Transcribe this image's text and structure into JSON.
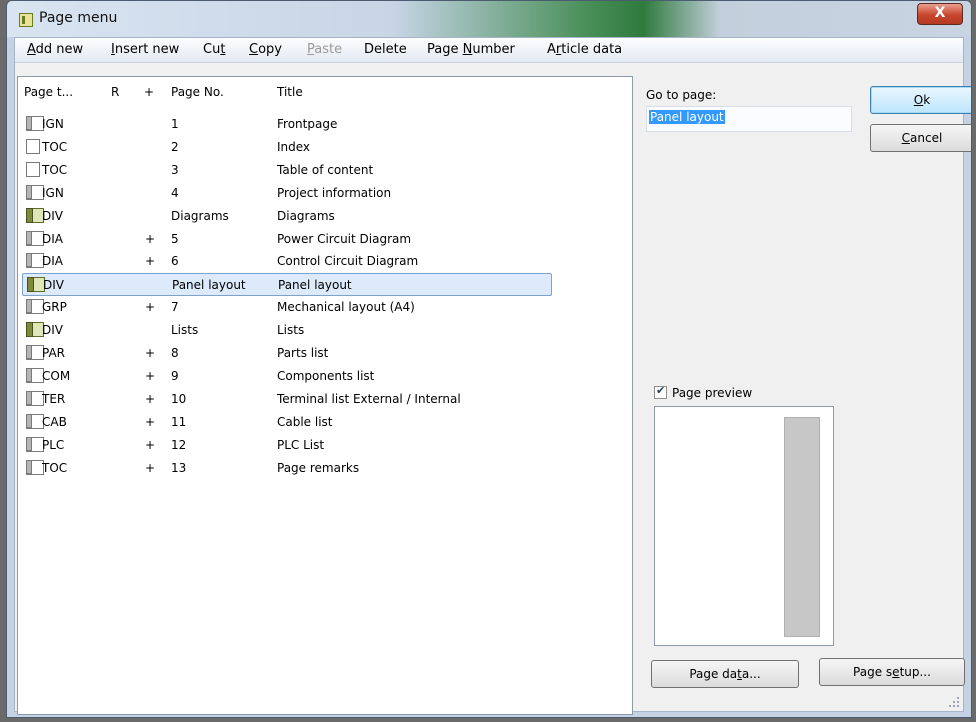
{
  "window": {
    "title": "Page menu",
    "close_glyph": "X"
  },
  "menubar": [
    {
      "label": "Add new",
      "u": "A",
      "rest": "dd new",
      "enabled": true
    },
    {
      "label": "Insert new",
      "u": "I",
      "rest": "nsert new",
      "enabled": true
    },
    {
      "label": "Cut",
      "pre": "Cu",
      "u": "t",
      "enabled": true
    },
    {
      "label": "Copy",
      "u": "C",
      "rest": "opy",
      "enabled": true
    },
    {
      "label": "Paste",
      "u": "P",
      "rest": "aste",
      "enabled": false
    },
    {
      "label": "Delete",
      "pre": "Delete",
      "enabled": true
    },
    {
      "label": "Page Number",
      "pre": "Page ",
      "u": "N",
      "rest": "umber",
      "enabled": true
    },
    {
      "label": "Article data",
      "pre": "A",
      "u": "r",
      "rest": "ticle data",
      "enabled": true
    }
  ],
  "table": {
    "columns": [
      "Page t...",
      "R",
      "+",
      "Page No.",
      "Title"
    ],
    "rows": [
      {
        "type": "IGN",
        "icon": "page-icon",
        "r": "",
        "plus": "",
        "page_no": "1",
        "title": "Frontpage"
      },
      {
        "type": "TOC",
        "icon": "page-icon",
        "r": "",
        "plus": "",
        "page_no": "2",
        "title": "Index"
      },
      {
        "type": "TOC",
        "icon": "page-icon",
        "r": "",
        "plus": "",
        "page_no": "3",
        "title": "Table of content"
      },
      {
        "type": "IGN",
        "icon": "page-icon",
        "r": "",
        "plus": "",
        "page_no": "4",
        "title": "Project information"
      },
      {
        "type": "DIV",
        "icon": "divider-page-icon",
        "r": "",
        "plus": "",
        "page_no": "Diagrams",
        "title": "Diagrams"
      },
      {
        "type": "DIA",
        "icon": "page-icon",
        "r": "",
        "plus": "+",
        "page_no": "5",
        "title": "Power Circuit Diagram"
      },
      {
        "type": "DIA",
        "icon": "page-icon",
        "r": "",
        "plus": "+",
        "page_no": "6",
        "title": "Control Circuit Diagram"
      },
      {
        "type": "DIV",
        "icon": "divider-page-icon",
        "r": "",
        "plus": "",
        "page_no": "Panel layout",
        "title": "Panel layout",
        "selected": true
      },
      {
        "type": "GRP",
        "icon": "page-icon",
        "r": "",
        "plus": "+",
        "page_no": "7",
        "title": "Mechanical layout (A4)"
      },
      {
        "type": "DIV",
        "icon": "divider-page-icon",
        "r": "",
        "plus": "",
        "page_no": "Lists",
        "title": "Lists"
      },
      {
        "type": "PAR",
        "icon": "page-icon",
        "r": "",
        "plus": "+",
        "page_no": "8",
        "title": "Parts list"
      },
      {
        "type": "COM",
        "icon": "page-icon",
        "r": "",
        "plus": "+",
        "page_no": "9",
        "title": "Components list"
      },
      {
        "type": "TER",
        "icon": "page-icon",
        "r": "",
        "plus": "+",
        "page_no": "10",
        "title": "Terminal list External / Internal"
      },
      {
        "type": "CAB",
        "icon": "page-icon",
        "r": "",
        "plus": "+",
        "page_no": "11",
        "title": "Cable list"
      },
      {
        "type": "PLC",
        "icon": "page-icon",
        "r": "",
        "plus": "+",
        "page_no": "12",
        "title": "PLC List"
      },
      {
        "type": "TOC",
        "icon": "page-icon",
        "r": "",
        "plus": "+",
        "page_no": "13",
        "title": "Page remarks"
      }
    ]
  },
  "goto": {
    "label": "Go to page:",
    "value": "Panel layout"
  },
  "buttons": {
    "ok": {
      "pre": "",
      "u": "O",
      "rest": "k"
    },
    "cancel": {
      "pre": "",
      "u": "C",
      "rest": "ancel"
    },
    "page_data": {
      "pre": "Page da",
      "u": "t",
      "rest": "a..."
    },
    "page_setup": {
      "pre": "Page s",
      "u": "e",
      "rest": "tup..."
    }
  },
  "preview": {
    "label": "Page preview",
    "checked": true
  },
  "colors": {
    "selection": "#3399ff",
    "row_highlight": "#ddeafb",
    "default_button": "#bde6fd"
  }
}
